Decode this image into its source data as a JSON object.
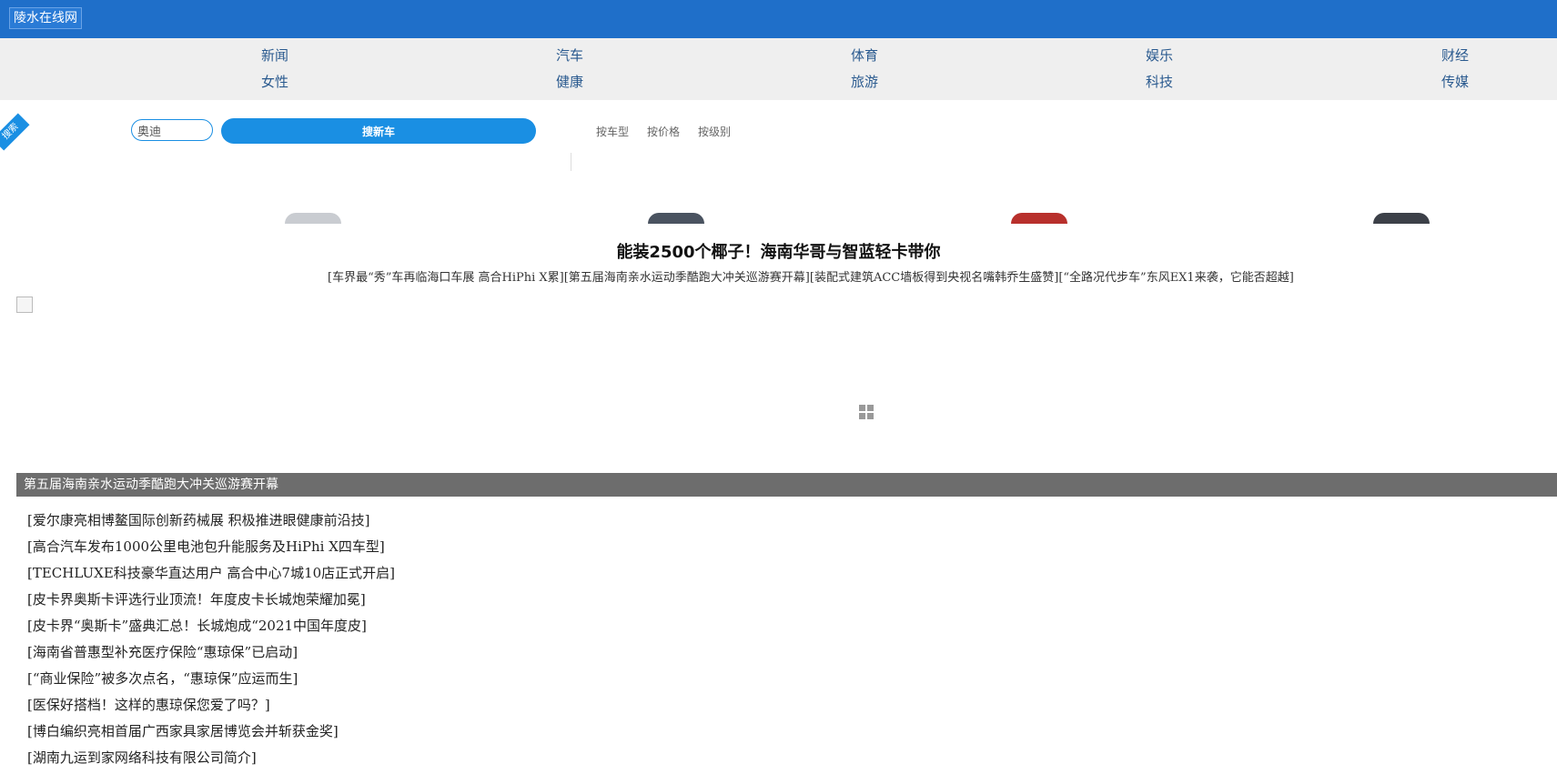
{
  "header": {
    "site_name": "陵水在线网"
  },
  "nav": {
    "row1": [
      "新闻",
      "汽车",
      "体育",
      "娱乐",
      "财经"
    ],
    "row2": [
      "女性",
      "健康",
      "旅游",
      "科技",
      "传媒"
    ]
  },
  "search": {
    "corner_badge": "搜索",
    "input_value": "奥迪",
    "button_label": "搜新车",
    "filter_tabs": [
      "按车型",
      "按价格",
      "按级别"
    ]
  },
  "feature": {
    "headline": "能装2500个椰子！海南华哥与智蓝轻卡带你",
    "sub_links": [
      "[车界最“秀”车再临海口车展 高合HiPhi X累]",
      "[第五届海南亲水运动季酷跑大冲关巡游赛开幕]",
      "[装配式建筑ACC墙板得到央视名嘴韩乔生盛赞]",
      "[“全路况代步车”东风EX1来袭，它能否超越]"
    ]
  },
  "slideshow": {
    "caption": "第五届海南亲水运动季酷跑大冲关巡游赛开幕"
  },
  "news_list": [
    "[爱尔康亮相博鳌国际创新药械展 积极推进眼健康前沿技]",
    "[高合汽车发布1000公里电池包升能服务及HiPhi X四车型]",
    "[TECHLUXE科技豪华直达用户 高合中心7城10店正式开启]",
    "[皮卡界奥斯卡评选行业顶流！年度皮卡长城炮荣耀加冕]",
    "[皮卡界“奥斯卡”盛典汇总！长城炮成“2021中国年度皮]",
    "[海南省普惠型补充医疗保险“惠琼保”已启动]",
    "[“商业保险”被多次点名，“惠琼保”应运而生]",
    "[医保好搭档！这样的惠琼保您爱了吗？]",
    "[博白编织亮相首届广西家具家居博览会并斩获金奖]",
    "[湖南九运到家网络科技有限公司简介]"
  ],
  "colors": {
    "brand_blue": "#1f6fc9",
    "accent_blue": "#1a8fe3",
    "nav_bg": "#efefef",
    "caption_bg": "#6d6d6d",
    "car_colors": [
      "#c9ccd1",
      "#4a5360",
      "#b8302c",
      "#3c4048"
    ]
  },
  "icons": {
    "broken_image": "broken-image-icon",
    "loader": "grid-loader-icon"
  }
}
